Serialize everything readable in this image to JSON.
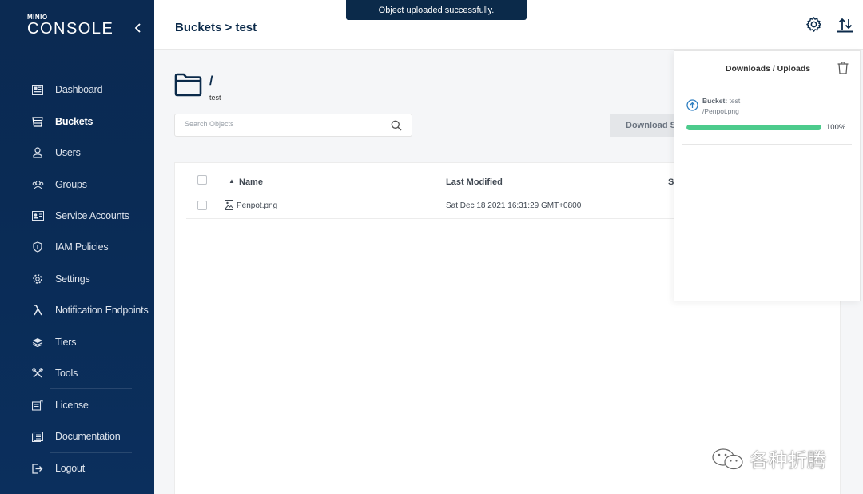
{
  "brand": {
    "top": "MINIO",
    "name": "CONSOLE"
  },
  "sidebar": {
    "collapse_label": "‹",
    "items": [
      {
        "label": "Dashboard",
        "icon": "dashboard-icon"
      },
      {
        "label": "Buckets",
        "icon": "buckets-icon",
        "active": true
      },
      {
        "label": "Users",
        "icon": "user-icon"
      },
      {
        "label": "Groups",
        "icon": "groups-icon"
      },
      {
        "label": "Service Accounts",
        "icon": "service-accounts-icon"
      },
      {
        "label": "IAM Policies",
        "icon": "shield-icon"
      },
      {
        "label": "Settings",
        "icon": "gear-icon"
      },
      {
        "label": "Notification Endpoints",
        "icon": "lambda-icon"
      },
      {
        "label": "Tiers",
        "icon": "tiers-icon"
      },
      {
        "label": "Tools",
        "icon": "tools-icon"
      },
      {
        "label": "License",
        "icon": "license-icon"
      },
      {
        "label": "Documentation",
        "icon": "documentation-icon"
      },
      {
        "label": "Logout",
        "icon": "logout-icon"
      }
    ]
  },
  "header": {
    "breadcrumb": "Buckets > test"
  },
  "toast": {
    "message": "Object uploaded successfully."
  },
  "main": {
    "path": "/",
    "bucket": "test",
    "search": {
      "placeholder": "Search Objects",
      "value": ""
    },
    "download_button": "Download S",
    "table": {
      "columns": [
        "Name",
        "Last Modified",
        "S"
      ],
      "rows": [
        {
          "name": "Penpot.png",
          "last_modified": "Sat Dec 18 2021 16:31:29 GMT+0800"
        }
      ]
    }
  },
  "panel": {
    "title": "Downloads / Uploads",
    "item": {
      "bucket_label": "Bucket:",
      "bucket_name": "test",
      "file": "/Penpot.png",
      "progress_text": "100%",
      "progress": 1.0
    }
  },
  "colors": {
    "sidebar": "#0b2a52",
    "accent": "#0b2a4a",
    "progress": "#4ccb8c"
  },
  "watermark": {
    "text": "各种折腾"
  }
}
